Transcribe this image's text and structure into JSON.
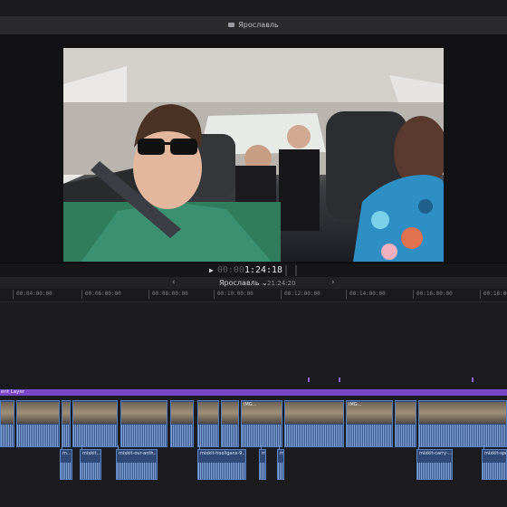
{
  "window": {
    "project_title": "Ярославль"
  },
  "viewer": {
    "timecode_dim": "00:00",
    "timecode_bright": "1:24:18"
  },
  "timeline": {
    "title": "Ярославль",
    "duration": "21:24:20",
    "ruler_labels": [
      "00:04:00:00",
      "00:06:00:00",
      "00:08:00:00",
      "00:10:00:00",
      "00:12:00:00",
      "00:14:00:00",
      "00:16:00:00",
      "00:18:00"
    ],
    "layer_label": "ent Layer",
    "primary_clips": [
      {
        "name": ""
      },
      {
        "name": ""
      },
      {
        "name": ""
      },
      {
        "name": ""
      },
      {
        "name": ""
      },
      {
        "name": ""
      },
      {
        "name": ""
      },
      {
        "name": ""
      },
      {
        "name": "IMG..."
      },
      {
        "name": ""
      },
      {
        "name": "IMG..."
      },
      {
        "name": ""
      },
      {
        "name": ""
      }
    ],
    "connected_clips": [
      {
        "name": "m..."
      },
      {
        "name": "mixkit..."
      },
      {
        "name": "mixkit-our-anth..."
      },
      {
        "name": "mixkit-hooligans-9..."
      },
      {
        "name": "m..."
      },
      {
        "name": "m..."
      },
      {
        "name": "mixkit-carry-..."
      },
      {
        "name": "mixkit-spo..."
      }
    ]
  },
  "icons": {
    "play": "play-icon",
    "prev": "chevron-left-icon",
    "next": "chevron-right-icon",
    "dropdown": "chevron-down-icon",
    "project": "clapper-icon"
  },
  "colors": {
    "accent_purple": "#7b47c9",
    "clip_blue": "#2f4a78"
  }
}
